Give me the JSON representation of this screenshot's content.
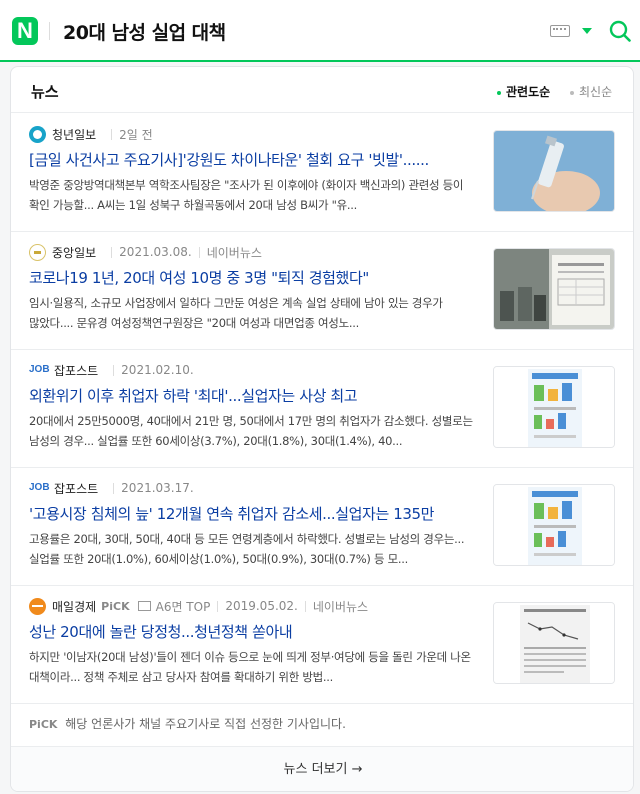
{
  "header": {
    "logo_letter": "N",
    "query": "20대 남성 실업 대책",
    "icons": [
      "keyboard-icon",
      "chevron-down-icon",
      "search-icon"
    ],
    "accent_color": "#03c75a"
  },
  "news": {
    "section_title": "뉴스",
    "sort_options": [
      "관련도순",
      "최신순"
    ],
    "items": [
      {
        "press": "청년일보",
        "date": "2일 전",
        "extra": "",
        "title": "[금일 사건사고 주요기사]'강원도 차이나타운' 철회 요구 '빗발'......",
        "desc": "박영준 중앙방역대책본부 역학조사팀장은 \"조사가 된 이후에야 (화이자 백신과의) 관련성 등이 확인 가능할... A씨는 1일 성북구 하월곡동에서 20대 남성 B씨가 \"유...",
        "logo_color": "#18a3c9"
      },
      {
        "press": "중앙일보",
        "date": "2021.03.08.",
        "extra": "네이버뉴스",
        "title": "코로나19 1년, 20대 여성 10명 중 3명 \"퇴직 경험했다\"",
        "desc": "임시·일용직, 소규모 사업장에서 일하다 그만둔 여성은 계속 실업 상태에 남아 있는 경우가 많았다.... 문유경 여성정책연구원장은 \"20대 여성과 대면업종 여성노...",
        "logo_color": "#d9c36b"
      },
      {
        "press": "잡포스트",
        "date": "2021.02.10.",
        "extra": "",
        "title": "외환위기 이후 취업자 하락 '최대'...실업자는 사상 최고",
        "desc": "20대에서 25만5000명, 40대에서 21만 명, 50대에서 17만 명의 취업자가 감소했다. 성별로는 남성의 경우... 실업률 또한 60세이상(3.7%), 20대(1.8%), 30대(1.4%), 40...",
        "logo_color": "#2a6fc9"
      },
      {
        "press": "잡포스트",
        "date": "2021.03.17.",
        "extra": "",
        "title": "'고용시장 침체의 늪' 12개월 연속 취업자 감소세...실업자는 135만",
        "desc": "고용률은 20대, 30대, 50대, 40대 등 모든 연령계층에서 하락했다. 성별로는 남성의 경우는... 실업률 또한 20대(1.0%), 60세이상(1.0%), 50대(0.9%), 30대(0.7%) 등 모...",
        "logo_color": "#2a6fc9"
      },
      {
        "press": "매일경제",
        "pick": "PiCK",
        "paper": "A6면 TOP",
        "date": "2019.05.02.",
        "extra": "네이버뉴스",
        "title": "성난 20대에 놀란 당정청...청년정책 쏟아내",
        "desc": "하지만 '이남자(20대 남성)'들이 젠더 이슈 등으로 눈에 띄게 정부·여당에 등을 돌린 가운데 나온 대책이라... 정책 주체로 삼고 당사자 참여를 확대하기 위한 방법...",
        "logo_color": "#f08a1c"
      }
    ],
    "pick_label": "PiCK",
    "pick_note": "해당 언론사가 채널 주요기사로 직접 선정한 기사입니다.",
    "more_label": "뉴스 더보기 →"
  }
}
